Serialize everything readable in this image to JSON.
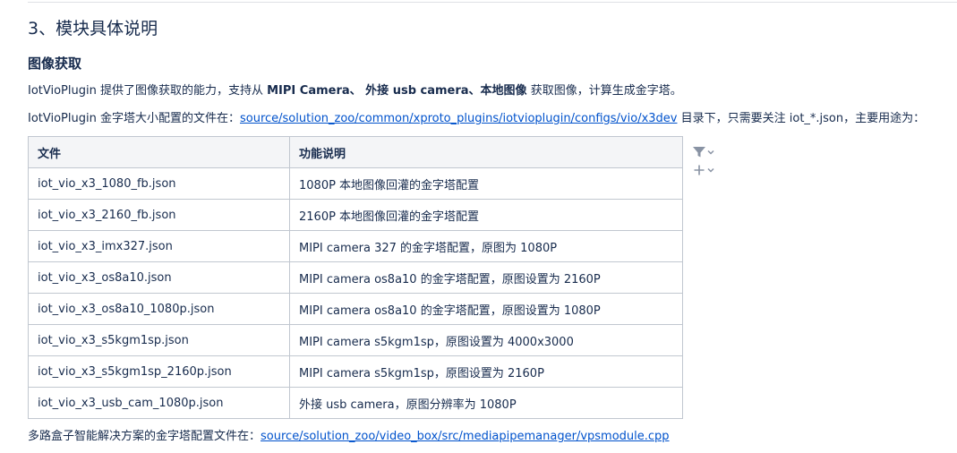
{
  "section": {
    "title": "3、模块具体说明"
  },
  "image_acquisition": {
    "heading": "图像获取",
    "p1": {
      "prefix": "IotVioPlugin 提供了图像获取的能力，支持从 ",
      "bold": "MIPI Camera、 外接 usb camera、本地图像",
      "suffix": " 获取图像，计算生成金字塔。"
    },
    "p2": {
      "prefix": "IotVioPlugin 金字塔大小配置的文件在：",
      "link": "source/solution_zoo/common/xproto_plugins/iotvioplugin/configs/vio/x3dev",
      "suffix": " 目录下，只需要关注 iot_*.json，主要用途为："
    },
    "table": {
      "headers": [
        "文件",
        "功能说明"
      ],
      "rows": [
        [
          "iot_vio_x3_1080_fb.json",
          "1080P 本地图像回灌的金字塔配置"
        ],
        [
          "iot_vio_x3_2160_fb.json",
          "2160P 本地图像回灌的金字塔配置"
        ],
        [
          "iot_vio_x3_imx327.json",
          "MIPI camera 327 的金字塔配置，原图为 1080P"
        ],
        [
          "iot_vio_x3_os8a10.json",
          "MIPI camera os8a10 的金字塔配置，原图设置为 2160P"
        ],
        [
          "iot_vio_x3_os8a10_1080p.json",
          "MIPI camera os8a10 的金字塔配置，原图设置为 1080P"
        ],
        [
          "iot_vio_x3_s5kgm1sp.json",
          "MIPI camera s5kgm1sp，原图设置为 4000x3000"
        ],
        [
          "iot_vio_x3_s5kgm1sp_2160p.json",
          "MIPI camera s5kgm1sp，原图设置为 2160P"
        ],
        [
          "iot_vio_x3_usb_cam_1080p.json",
          "外接 usb camera，原图分辨率为 1080P"
        ]
      ]
    },
    "p3": {
      "prefix": "多路盒子智能解决方案的金字塔配置文件在：",
      "link": "source/solution_zoo/video_box/src/mediapipemanager/vpsmodule.cpp"
    }
  },
  "tools": {
    "icons": [
      "filter-icon",
      "plus-icon",
      "chevron-down-icon"
    ]
  }
}
